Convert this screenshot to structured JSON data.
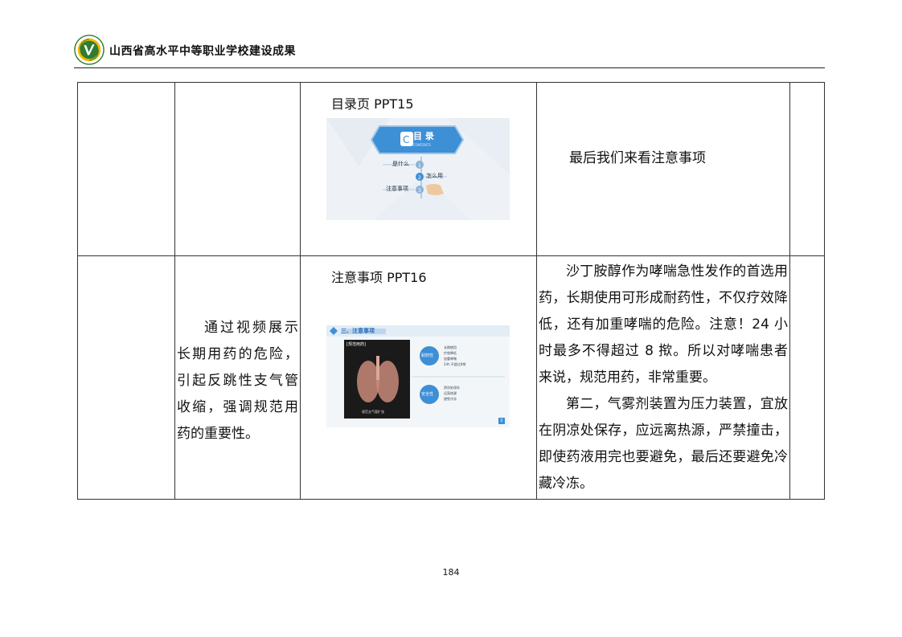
{
  "header": {
    "title": "山西省高水平中等职业学校建设成果",
    "logo_color": "#2e7d32",
    "logo_accent": "#f6b800"
  },
  "rows": [
    {
      "goal_text": "",
      "ppt_title": "目录页 PPT15",
      "slide": {
        "heading": "目 录",
        "subheading": "CONTENTS",
        "items": [
          {
            "label": "是什么",
            "num": "1"
          },
          {
            "label": "怎么用",
            "num": "2"
          },
          {
            "label": "注意事项",
            "num": "3"
          }
        ]
      },
      "content_paragraphs": [
        "最后我们来看注意事项"
      ]
    },
    {
      "goal_text": "通过视频展示长期用药的危险，引起反跳性支气管收缩，强调规范用药的重要性。",
      "ppt_title": "注意事项 PPT16",
      "slide": {
        "heading": "三、注意事项",
        "image_label": "[规范用药]",
        "image_caption": "规范支气管扩张",
        "bubble1": "耐药性",
        "bubble1_items": [
          "长期使用",
          "疗效降低",
          "加重哮喘",
          "24h 不超过8揿"
        ],
        "bubble2": "安全性",
        "bubble2_items": [
          "阴凉处保存",
          "远离热源",
          "避免冷冻"
        ],
        "corner_badge": "3"
      },
      "content_paragraphs": [
        "沙丁胺醇作为哮喘急性发作的首选用药，长期使用可形成耐药性，不仅疗效降低，还有加重哮喘的危险。注意！24 小时最多不得超过 8 揿。所以对哮喘患者来说，规范用药，非常重要。",
        "第二，气雾剂装置为压力装置，宜放在阴凉处保存，应远离热源，严禁撞击，即使药液用完也要避免，最后还要避免冷藏冷冻。"
      ]
    }
  ],
  "footer": {
    "page_number": "184"
  }
}
